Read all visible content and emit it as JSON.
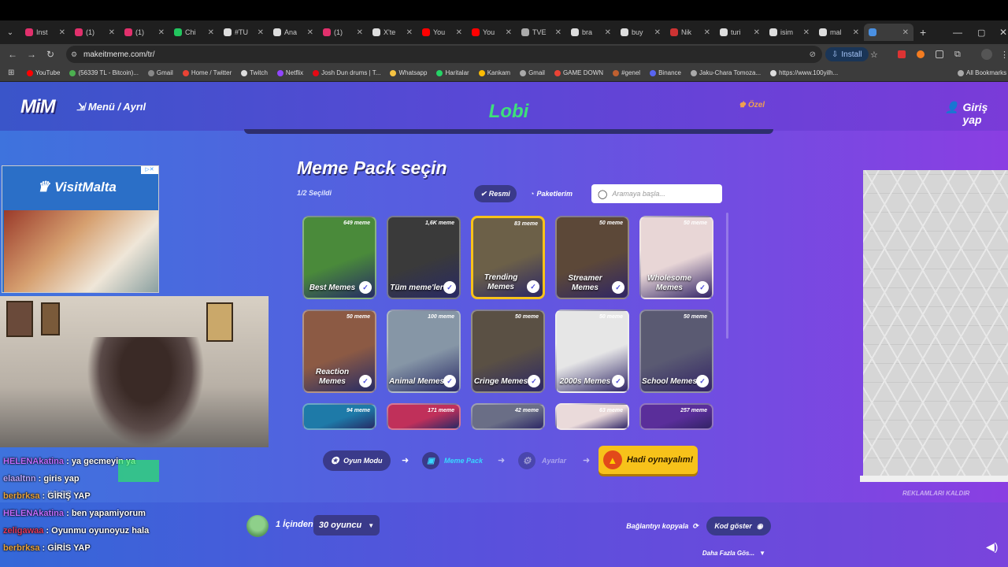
{
  "browser": {
    "tabs": [
      "Inst",
      "(1)",
      "(1)",
      "Chi",
      "#TU",
      "Ana",
      "(1)",
      "X'te",
      "You",
      "You",
      "TVE",
      "bra",
      "buy",
      "Nik",
      "turi",
      "isim",
      "mal",
      ""
    ],
    "url": "makeitmeme.com/tr/",
    "install_label": "Install",
    "bookmarks": [
      "YouTube",
      "(56339 TL - Bitcoin)...",
      "Gmail",
      "Home / Twitter",
      "Twitch",
      "Netflix",
      "Josh Dun drums | T...",
      "Whatsapp",
      "Haritalar",
      "Kankam",
      "Gmail",
      "GAME DOWN",
      "#genel",
      "Binance",
      "Jaku-Chara Tomoza...",
      "https://www.100yilh...",
      "All Bookmarks"
    ]
  },
  "site": {
    "logo": "MiM",
    "menu_label": "Menü / Ayrıl",
    "lobby_title": "Lobi",
    "special_label": "Özel",
    "login_label": "Giriş yap",
    "heading": "Meme Pack seçin",
    "selected_count": "1/2 Seçildi",
    "filter_official": "Resmi",
    "filter_mypacks": "Paketlerim",
    "search_placeholder": "Aramaya başla...",
    "ad_brand": "VisitMalta",
    "remove_ads": "REKLAMLARI KALDIR",
    "remove_ads_left": "KALDIR"
  },
  "packs": [
    {
      "label": "Best Memes",
      "count": "649 meme",
      "bg": "#4a8a3a"
    },
    {
      "label": "Tüm meme'ler",
      "count": "1,6K meme",
      "bg": "#3a3a3a"
    },
    {
      "label": "Trending Memes",
      "count": "83 meme",
      "bg": "#6c6048"
    },
    {
      "label": "Streamer Memes",
      "count": "50 meme",
      "bg": "#5c4838"
    },
    {
      "label": "Wholesome Memes",
      "count": "50 meme",
      "bg": "#e8d6d6"
    },
    {
      "label": "Reaction Memes",
      "count": "50 meme",
      "bg": "#8c5a44"
    },
    {
      "label": "Animal Memes",
      "count": "100 meme",
      "bg": "#8696a6"
    },
    {
      "label": "Cringe Memes",
      "count": "50 meme",
      "bg": "#5a5044"
    },
    {
      "label": "2000s Memes",
      "count": "50 meme",
      "bg": "#e6e6e6"
    },
    {
      "label": "School Memes",
      "count": "50 meme",
      "bg": "#5a5a72"
    },
    {
      "label": "",
      "count": "94 meme",
      "bg": "#1e7aa8"
    },
    {
      "label": "",
      "count": "171 meme",
      "bg": "#c0305a"
    },
    {
      "label": "",
      "count": "42 meme",
      "bg": "#6a6e86"
    },
    {
      "label": "",
      "count": "63 meme",
      "bg": "#eadada"
    },
    {
      "label": "",
      "count": "257 meme",
      "bg": "#5a2e9a"
    }
  ],
  "steps": {
    "game_mode": "Oyun Modu",
    "meme_pack": "Meme Pack",
    "settings": "Ayarlar",
    "play": "Hadi oynayalım!"
  },
  "bottom": {
    "players_prefix": "1 İçinden",
    "players_value": "30 oyuncu",
    "copy_link": "Bağlantıyı kopyala",
    "show_code": "Kod göster",
    "more": "Daha Fazla Gös..."
  },
  "chat": [
    {
      "user": "HELENAkatina",
      "msg": ": ya gecmeyin ya",
      "color": "#c06cff"
    },
    {
      "user": "elaaltnn",
      "msg": ": giris yap",
      "color": "#b9a6ff"
    },
    {
      "user": "berbrksa",
      "msg": ": GİRİŞ YAP",
      "color": "#e8a33c"
    },
    {
      "user": "HELENAkatina",
      "msg": ": ben yapamiyorum",
      "color": "#c06cff"
    },
    {
      "user": "zeligawaa",
      "msg": ": Oyunmu oyunoyuz hala",
      "color": "#e0385a"
    },
    {
      "user": "berbrksa",
      "msg": ": GİRİS YAP",
      "color": "#e8a33c"
    }
  ]
}
